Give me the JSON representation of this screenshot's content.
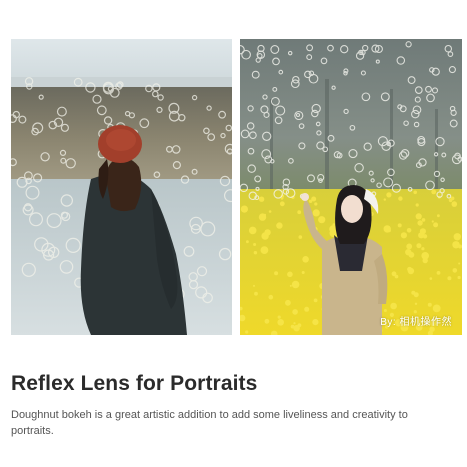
{
  "photos": {
    "left": {
      "subject": "woman-in-red-beret-by-water"
    },
    "right": {
      "subject": "woman-in-rapeseed-field",
      "watermark": "By: 相机操作然"
    }
  },
  "title": "Reflex Lens for Portraits",
  "description": "Doughnut bokeh is a great artistic addition to add some liveliness and creativity to portraits.",
  "colors": {
    "title": "#2b2b2b",
    "body": "#555555",
    "bokeh_field": "#f3d624"
  }
}
